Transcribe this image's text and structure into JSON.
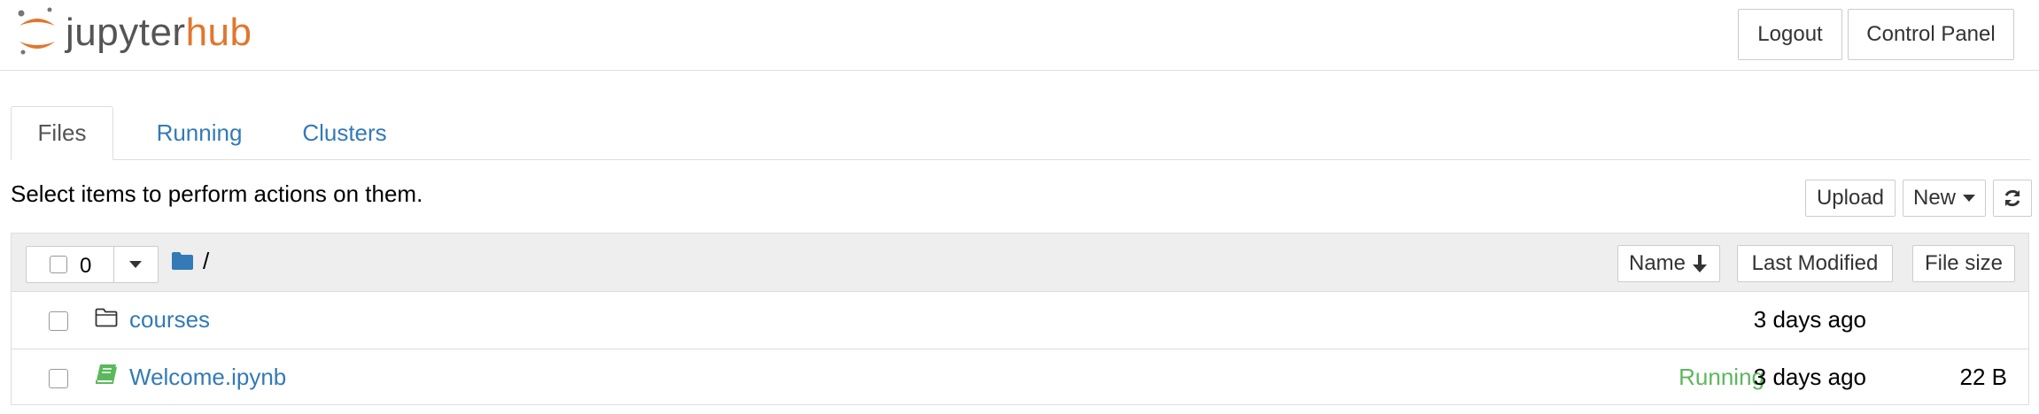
{
  "header": {
    "logo": {
      "part1": "jupyter",
      "part2": "hub"
    },
    "logout_label": "Logout",
    "control_panel_label": "Control Panel"
  },
  "tabs": [
    {
      "label": "Files",
      "active": true
    },
    {
      "label": "Running",
      "active": false
    },
    {
      "label": "Clusters",
      "active": false
    }
  ],
  "toolbar": {
    "info_text": "Select items to perform actions on them.",
    "upload_label": "Upload",
    "new_label": "New",
    "refresh_icon": "refresh-icon"
  },
  "file_list": {
    "selected_count": "0",
    "path": "/",
    "columns": {
      "name": "Name",
      "last_modified": "Last Modified",
      "file_size": "File size"
    },
    "sort": {
      "column": "Name",
      "direction": "descending"
    },
    "rows": [
      {
        "name": "courses",
        "type": "folder",
        "icon": "folder-icon",
        "running": "",
        "modified": "3 days ago",
        "size": ""
      },
      {
        "name": "Welcome.ipynb",
        "type": "notebook",
        "icon": "notebook-icon",
        "running": "Running",
        "modified": "3 days ago",
        "size": "22 B"
      }
    ]
  },
  "colors": {
    "link": "#337ab7",
    "running": "#5cb85c",
    "brand_orange": "#e0772e",
    "notebook_green": "#5cb85c",
    "folder_blue": "#337ab7"
  }
}
